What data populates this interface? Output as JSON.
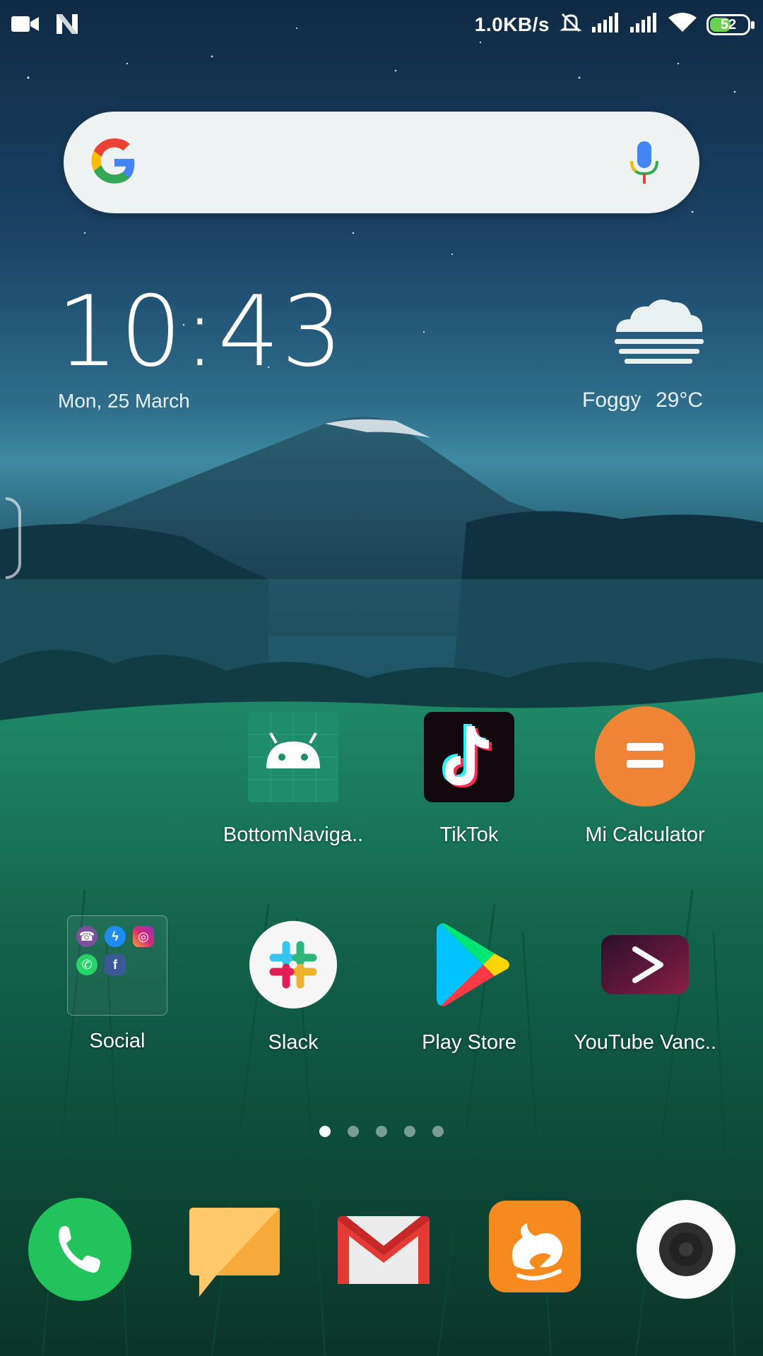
{
  "status_bar": {
    "network_speed": "1.0KB/s",
    "battery_level": "52",
    "icons": [
      "video-camera-icon",
      "n-icon",
      "silent-bell-icon",
      "signal-icon",
      "signal-icon",
      "wifi-icon",
      "battery-icon"
    ]
  },
  "search": {
    "logo": "google-g-icon",
    "mic": "mic-icon"
  },
  "clock": {
    "time": "10:43",
    "date": "Mon, 25 March"
  },
  "weather": {
    "condition": "Foggy",
    "temperature": "29°C",
    "icon": "fog-cloud-icon"
  },
  "apps": [
    {
      "label": "BottomNaviga..",
      "icon": "android-icon"
    },
    {
      "label": "TikTok",
      "icon": "tiktok-icon"
    },
    {
      "label": "Mi Calculator",
      "icon": "calculator-icon"
    },
    {
      "label": "Social",
      "icon": "folder-icon"
    },
    {
      "label": "Slack",
      "icon": "slack-icon"
    },
    {
      "label": "Play Store",
      "icon": "play-store-icon"
    },
    {
      "label": "YouTube Vanc..",
      "icon": "youtube-vanced-icon"
    }
  ],
  "folder_apps": [
    "viber-icon",
    "messenger-icon",
    "instagram-icon",
    "whatsapp-icon",
    "facebook-icon"
  ],
  "pages": {
    "count": 5,
    "active": 1
  },
  "dock": [
    {
      "icon": "phone-icon"
    },
    {
      "icon": "messages-icon"
    },
    {
      "icon": "gmail-icon"
    },
    {
      "icon": "uc-browser-icon"
    },
    {
      "icon": "camera-icon"
    }
  ],
  "colors": {
    "calculator": "#f08436",
    "android_tile": "#1f8c6a",
    "phone": "#22c25d",
    "messages": "#ffc86a",
    "uc_browser": "#f68a1e"
  }
}
